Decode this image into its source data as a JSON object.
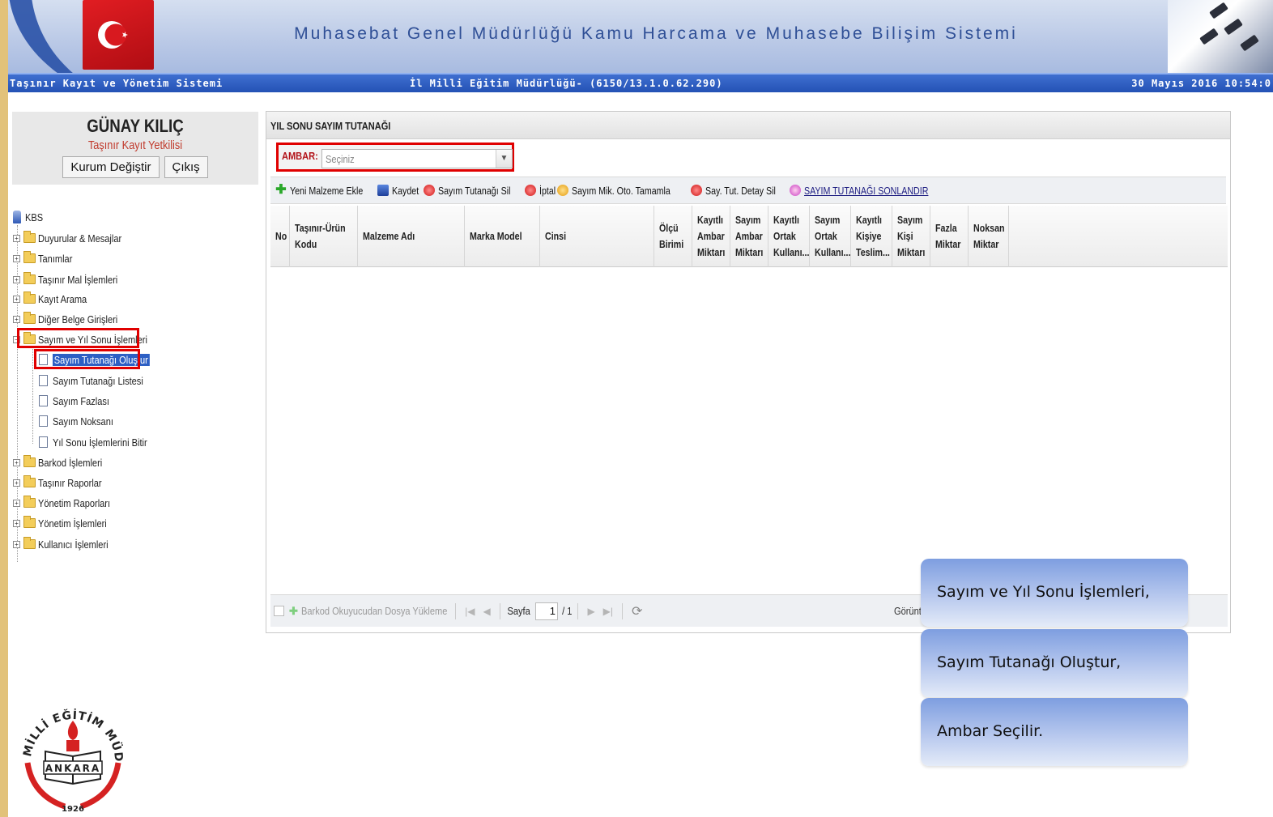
{
  "header": {
    "site_title": "Muhasebat Genel Müdürlüğü Kamu Harcama ve Muhasebe Bilişim Sistemi",
    "app_name": "Taşınır Kayıt ve Yönetim Sistemi",
    "institution": "İl Milli Eğitim Müdürlüğü- (6150/13.1.0.62.290)",
    "datetime": "30 Mayıs 2016 10:54:0"
  },
  "user": {
    "name": "GÜNAY KILIÇ",
    "role": "Taşınır Kayıt Yetkilisi",
    "change_institution": "Kurum Değiştir",
    "logout": "Çıkış"
  },
  "tree": {
    "root": "KBS",
    "items": [
      "Duyurular & Mesajlar",
      "Tanımlar",
      "Taşınır Mal İşlemleri",
      "Kayıt Arama",
      "Diğer Belge Girişleri",
      "Sayım ve Yıl Sonu İşlemleri"
    ],
    "sub_items": [
      "Sayım Tutanağı Oluştur",
      "Sayım Tutanağı Listesi",
      "Sayım Fazlası",
      "Sayım Noksanı",
      "Yıl Sonu İşlemlerini Bitir"
    ],
    "items_after": [
      "Barkod İşlemleri",
      "Taşınır Raporlar",
      "Yönetim Raporları",
      "Yönetim İşlemleri",
      "Kullanıcı İşlemleri"
    ]
  },
  "panel": {
    "title": "YIL SONU SAYIM TUTANAĞI",
    "ambar_label": "AMBAR:",
    "ambar_value": "Seçiniz"
  },
  "toolbar": {
    "new_item": "Yeni Malzeme Ekle",
    "save": "Kaydet",
    "delete_report": "Sayım Tutanağı Sil",
    "cancel": "İptal",
    "auto_complete": "Sayım Mik. Oto. Tamamla",
    "delete_detail": "Say. Tut. Detay Sil",
    "finalize": "SAYIM TUTANAĞI SONLANDIR"
  },
  "grid": {
    "columns": [
      "No",
      "Taşınır-Ürün\nKodu",
      "Malzeme Adı",
      "Marka Model",
      "Cinsi",
      "Ölçü\nBirimi",
      "Kayıtlı\nAmbar\nMiktarı",
      "Sayım\nAmbar\nMiktarı",
      "Kayıtlı\nOrtak\nKullanı...",
      "Sayım\nOrtak\nKullanı...",
      "Kayıtlı\nKişiye\nTeslim...",
      "Sayım\nKişi\nMiktarı",
      "Fazla\nMiktar",
      "Noksan\nMiktar"
    ]
  },
  "pager": {
    "barcode_upload": "Barkod Okuyucudan Dosya Yükleme",
    "page_label": "Sayfa",
    "page_value": "1",
    "page_total": "/ 1",
    "display": "Görüntü"
  },
  "callouts": [
    "Sayım ve Yıl Sonu İşlemleri,",
    "Sayım Tutanağı Oluştur,",
    "Ambar Seçilir."
  ],
  "logo": {
    "top_text": "MİLLİ EĞİTİM MÜDÜRLÜĞÜ",
    "city": "ANKARA",
    "year": "1926"
  }
}
